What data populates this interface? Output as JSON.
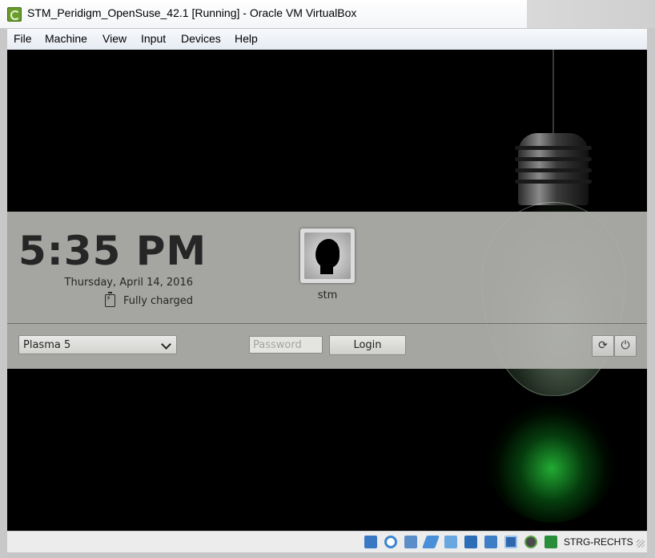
{
  "window": {
    "title": "STM_Peridigm_OpenSuse_42.1 [Running] - Oracle VM VirtualBox",
    "app_icon": "virtualbox-icon"
  },
  "menubar": {
    "items": [
      "File",
      "Machine",
      "View",
      "Input",
      "Devices",
      "Help"
    ]
  },
  "login": {
    "time": "5:35 PM",
    "date": "Thursday, April 14, 2016",
    "battery_status": "Fully charged",
    "username": "stm",
    "session": "Plasma 5",
    "password_placeholder": "Password",
    "login_label": "Login",
    "switch_icon": "refresh-icon",
    "power_icon": "power-icon"
  },
  "statusbar": {
    "icons": [
      "hard-disk-icon",
      "optical-drive-icon",
      "audio-icon",
      "network-icon",
      "usb-icon",
      "shared-folder-icon",
      "display-icon",
      "video-capture-icon",
      "cpu-icon",
      "mouse-integration-icon",
      "keyboard-icon"
    ],
    "host_key": "STRG-RECHTS"
  },
  "colors": {
    "panel": "#b2b2ae",
    "bulb_glow": "#1fc23a",
    "screen_bg": "#000000"
  }
}
